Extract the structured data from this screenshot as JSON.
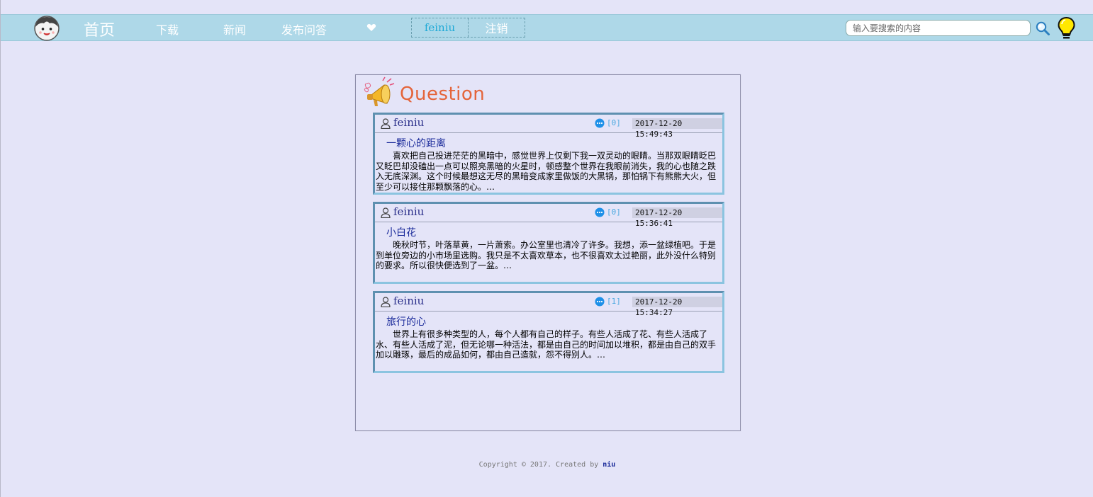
{
  "nav": {
    "home": "首页",
    "download": "下载",
    "news": "新闻",
    "ask": "发布问答",
    "username": "feiniu",
    "logout": "注销"
  },
  "search": {
    "placeholder": "输入要搜索的内容"
  },
  "panel": {
    "title": "Question"
  },
  "questions": [
    {
      "author": "feiniu",
      "comments": "[0]",
      "time": "2017-12-20 15:49:43",
      "title": "一颗心的距离",
      "excerpt": "喜欢把自己投进茫茫的黑暗中，感觉世界上仅剩下我一双灵动的眼睛。当那双眼睛眨巴又眨巴却没磕出一点可以照亮黑暗的火星时，顿感整个世界在我眼前消失，我的心也随之跌入无底深渊。这个时候最想这无尽的黑暗变成家里做饭的大黑锅，那怕锅下有熊熊大火，但至少可以接住那颗飘落的心。…"
    },
    {
      "author": "feiniu",
      "comments": "[0]",
      "time": "2017-12-20 15:36:41",
      "title": "小白花",
      "excerpt": "晚秋时节，叶落草黄，一片萧索。办公室里也清冷了许多。我想，添一盆绿植吧。于是到单位旁边的小市场里选购。我只是不太喜欢草本，也不很喜欢太过艳丽，此外没什么特别的要求。所以很快便选到了一盆。…"
    },
    {
      "author": "feiniu",
      "comments": "[1]",
      "time": "2017-12-20 15:34:27",
      "title": "旅行的心",
      "excerpt": "世界上有很多种类型的人，每个人都有自己的样子。有些人活成了花、有些人活成了水、有些人活成了泥，但无论哪一种活法，都是由自己的时间加以堆积，都是由自己的双手加以雕琢，最后的成品如何，都由自己造就，怨不得别人。…"
    }
  ],
  "footer": {
    "text": "Copyright © 2017. Created by ",
    "author": "niu"
  },
  "colors": {
    "navbar": "#aed8e8",
    "background": "#e4e4f8",
    "title": "#e4643a",
    "link": "#1a2a9a"
  }
}
